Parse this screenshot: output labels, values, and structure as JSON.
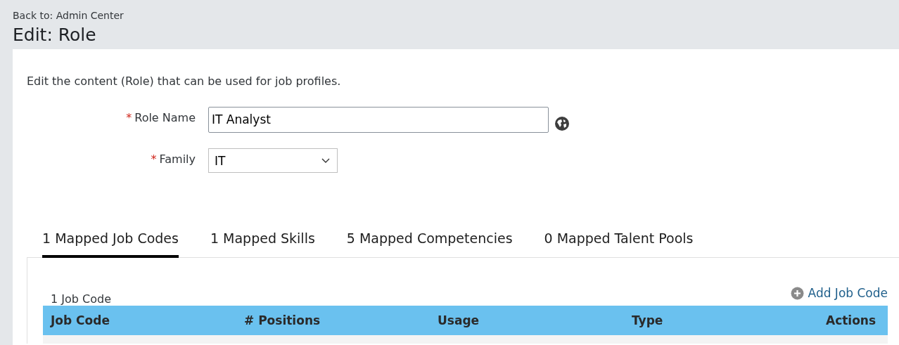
{
  "header": {
    "back_link": "Back to: Admin Center",
    "title": "Edit: Role"
  },
  "description": "Edit the content (Role) that can be used for job profiles.",
  "form": {
    "fields": [
      {
        "kind": "text",
        "required_mark": "*",
        "label": "Role Name",
        "value": "IT Analyst"
      },
      {
        "kind": "select",
        "required_mark": "*",
        "label": "Family",
        "value": "IT"
      }
    ]
  },
  "tabs": [
    {
      "label": "1 Mapped Job Codes",
      "selected": true
    },
    {
      "label": "1 Mapped Skills",
      "selected": false
    },
    {
      "label": "5 Mapped Competencies",
      "selected": false
    },
    {
      "label": "0 Mapped Talent Pools",
      "selected": false
    }
  ],
  "job_codes": {
    "count": "1 Job Code",
    "add_link": "Add Job Code",
    "table": {
      "columns": [
        "Job Code",
        "# Positions",
        "Usage",
        "Type",
        "Actions"
      ]
    }
  }
}
